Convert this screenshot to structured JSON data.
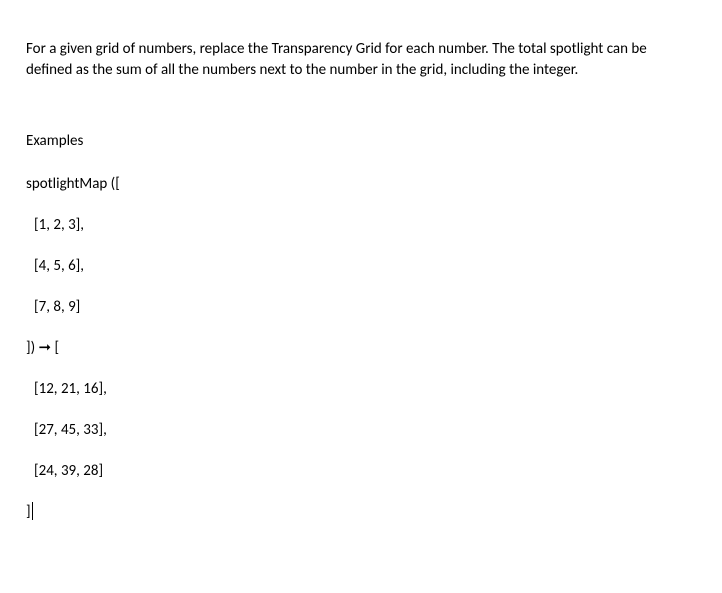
{
  "intro": "For a given grid of numbers, replace the Transparency Grid for each number. The total spotlight can be defined as the sum of all the numbers next to the number in the grid, including the integer.",
  "examplesHeading": "Examples",
  "code": {
    "line1": "spotlightMap ([",
    "line2": "[1, 2, 3],",
    "line3": "[4, 5, 6],",
    "line4": "[7, 8, 9]",
    "line5": "]) ➞ [",
    "line6": "[12, 21, 16],",
    "line7": "[27, 45, 33],",
    "line8": "[24, 39, 28]",
    "line9": "]"
  }
}
